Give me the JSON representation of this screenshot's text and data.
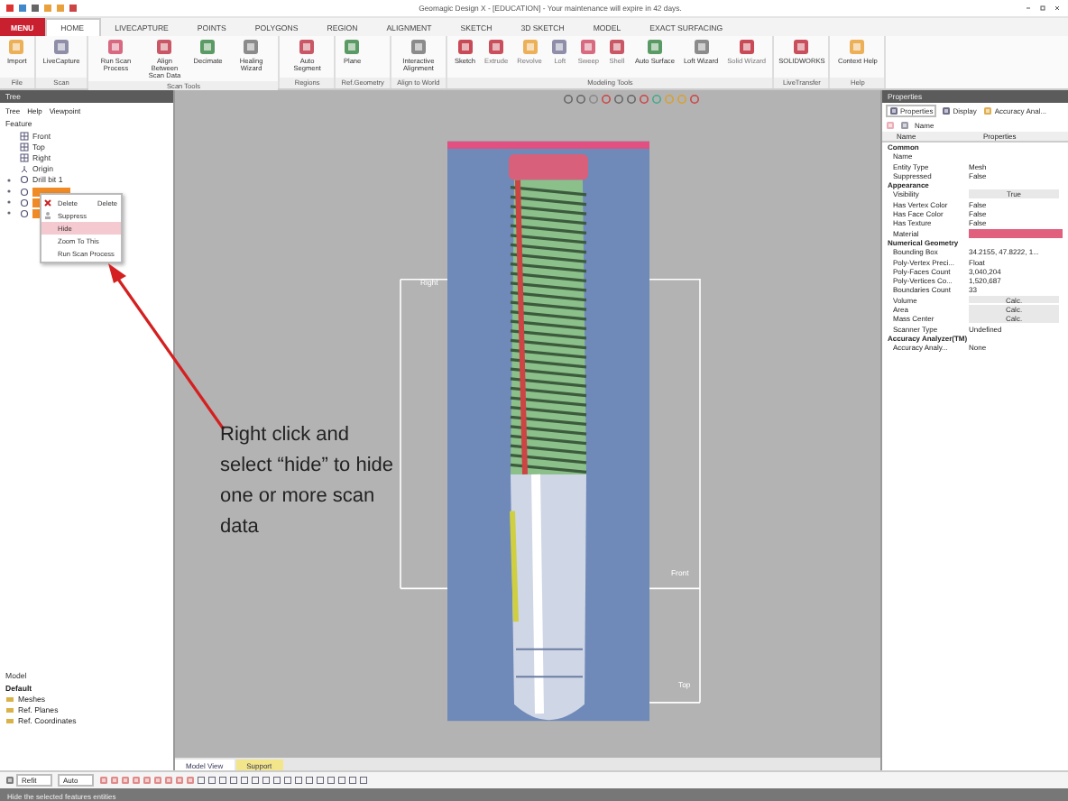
{
  "window": {
    "title": "Geomagic Design X - [EDUCATION] - Your maintenance will expire in 42 days."
  },
  "ribbon_tabs": [
    {
      "label": "MENU",
      "kind": "menu",
      "selected": false
    },
    {
      "label": "HOME",
      "kind": "tab",
      "selected": true
    },
    {
      "label": "LIVECAPTURE",
      "kind": "tab",
      "selected": false
    },
    {
      "label": "POINTS",
      "kind": "tab",
      "selected": false
    },
    {
      "label": "POLYGONS",
      "kind": "tab",
      "selected": false
    },
    {
      "label": "REGION",
      "kind": "tab",
      "selected": false
    },
    {
      "label": "ALIGNMENT",
      "kind": "tab",
      "selected": false
    },
    {
      "label": "SKETCH",
      "kind": "tab",
      "selected": false
    },
    {
      "label": "3D SKETCH",
      "kind": "tab",
      "selected": false
    },
    {
      "label": "MODEL",
      "kind": "tab",
      "selected": false
    },
    {
      "label": "EXACT SURFACING",
      "kind": "tab",
      "selected": false
    }
  ],
  "ribbon_groups": [
    {
      "label": "File",
      "buttons": [
        {
          "label": "Import",
          "disabled": false
        }
      ]
    },
    {
      "label": "Scan",
      "buttons": [
        {
          "label": "LiveCapture",
          "disabled": false
        }
      ]
    },
    {
      "label": "Scan Tools",
      "buttons": [
        {
          "label": "Run Scan Process",
          "disabled": false
        },
        {
          "label": "Align Between Scan Data",
          "disabled": false
        },
        {
          "label": "Decimate",
          "disabled": false
        },
        {
          "label": "Healing Wizard",
          "disabled": false
        }
      ]
    },
    {
      "label": "Regions",
      "buttons": [
        {
          "label": "Auto Segment",
          "disabled": false
        }
      ]
    },
    {
      "label": "Ref.Geometry",
      "buttons": [
        {
          "label": "Plane",
          "disabled": false
        }
      ]
    },
    {
      "label": "Align to World",
      "buttons": [
        {
          "label": "Interactive Alignment",
          "disabled": false
        }
      ]
    },
    {
      "label": "Modeling Tools",
      "buttons": [
        {
          "label": "Sketch",
          "disabled": false
        },
        {
          "label": "Extrude",
          "disabled": true
        },
        {
          "label": "Revolve",
          "disabled": true
        },
        {
          "label": "Loft",
          "disabled": true
        },
        {
          "label": "Sweep",
          "disabled": true
        },
        {
          "label": "Shell",
          "disabled": true
        },
        {
          "label": "Auto Surface",
          "disabled": false
        },
        {
          "label": "Loft Wizard",
          "disabled": false
        },
        {
          "label": "Solid Wizard",
          "disabled": true
        }
      ]
    },
    {
      "label": "LiveTransfer",
      "buttons": [
        {
          "label": "SOLIDWORKS",
          "disabled": false
        }
      ]
    },
    {
      "label": "Help",
      "buttons": [
        {
          "label": "Context Help",
          "disabled": false
        }
      ]
    }
  ],
  "tree_panel": {
    "title": "Tree",
    "toolbar": [
      "Tree",
      "Help",
      "Viewpoint"
    ],
    "heading": "Feature",
    "items": [
      {
        "label": "Front",
        "kind": "plane",
        "selected": false
      },
      {
        "label": "Top",
        "kind": "plane",
        "selected": false
      },
      {
        "label": "Right",
        "kind": "plane",
        "selected": false
      },
      {
        "label": "Origin",
        "kind": "origin",
        "selected": false
      },
      {
        "label": "Drill bit 1",
        "kind": "scan",
        "selected": false
      },
      {
        "kind": "scan",
        "selected": true
      },
      {
        "kind": "scan",
        "selected": true
      },
      {
        "kind": "scan",
        "selected": true
      }
    ]
  },
  "context_menu": [
    {
      "label": "Delete",
      "shortcut": "Delete",
      "kind": "delete",
      "selected": false
    },
    {
      "label": "Suppress",
      "kind": "suppress",
      "selected": false
    },
    {
      "label": "Hide",
      "kind": "plain",
      "selected": true
    },
    {
      "label": "Zoom To This",
      "kind": "plain",
      "selected": false
    },
    {
      "label": "Run Scan Process",
      "kind": "plain",
      "selected": false
    }
  ],
  "model_panel": {
    "title": "Model",
    "items": [
      {
        "label": "Default",
        "kind": "root"
      },
      {
        "label": "Meshes",
        "kind": "folder"
      },
      {
        "label": "Ref. Planes",
        "kind": "folder"
      },
      {
        "label": "Ref. Coordinates",
        "kind": "folder"
      }
    ]
  },
  "viewport": {
    "plane_labels": [
      "Right",
      "Front",
      "Top"
    ],
    "view_tabs": [
      {
        "label": "Model View",
        "selected": true
      },
      {
        "label": "Support",
        "selected": false
      }
    ]
  },
  "annotation": "Right click and select “hide” to hide one or more scan data",
  "properties_panel": {
    "title": "Properties",
    "tabs": [
      {
        "label": "Properties",
        "selected": true
      },
      {
        "label": "Display",
        "selected": false
      },
      {
        "label": "Accuracy Anal...",
        "selected": false
      }
    ],
    "name_label": "Name",
    "columns": [
      "Name",
      "Properties"
    ],
    "sections": [
      {
        "title": "Common",
        "rows": [
          {
            "name": "Name",
            "kind": "text"
          },
          {
            "name": "Entity Type",
            "value": "Mesh",
            "kind": "text"
          },
          {
            "name": "Suppressed",
            "value": "False",
            "kind": "text"
          }
        ]
      },
      {
        "title": "Appearance",
        "rows": [
          {
            "name": "Visibility",
            "value": "True",
            "kind": "button"
          },
          {
            "name": "Has Vertex Color",
            "value": "False",
            "kind": "text"
          },
          {
            "name": "Has Face Color",
            "value": "False",
            "kind": "text"
          },
          {
            "name": "Has Texture",
            "value": "False",
            "kind": "text"
          },
          {
            "name": "Material",
            "kind": "swatch",
            "color": "#e0607e"
          }
        ]
      },
      {
        "title": "Numerical Geometry",
        "rows": [
          {
            "name": "Bounding Box",
            "value": "34.2155, 47.8222, 1...",
            "kind": "text"
          },
          {
            "name": "Poly-Vertex Preci...",
            "value": "Float",
            "kind": "text"
          },
          {
            "name": "Poly-Faces Count",
            "value": "3,040,204",
            "kind": "text"
          },
          {
            "name": "Poly-Vertices Co...",
            "value": "1,520,687",
            "kind": "text"
          },
          {
            "name": "Boundaries Count",
            "value": "33",
            "kind": "text"
          },
          {
            "name": "Volume",
            "value": "Calc.",
            "kind": "button"
          },
          {
            "name": "Area",
            "value": "Calc.",
            "kind": "button"
          },
          {
            "name": "Mass Center",
            "value": "Calc.",
            "kind": "button"
          },
          {
            "name": "Scanner Type",
            "value": "Undefined",
            "kind": "text"
          }
        ]
      },
      {
        "title": "Accuracy Analyzer(TM)",
        "rows": [
          {
            "name": "Accuracy Analy...",
            "value": "None",
            "kind": "text"
          }
        ]
      }
    ]
  },
  "bottom_toolbar": {
    "fields": [
      "Refit",
      "Auto"
    ]
  },
  "status_bar": "Hide the selected features entities"
}
